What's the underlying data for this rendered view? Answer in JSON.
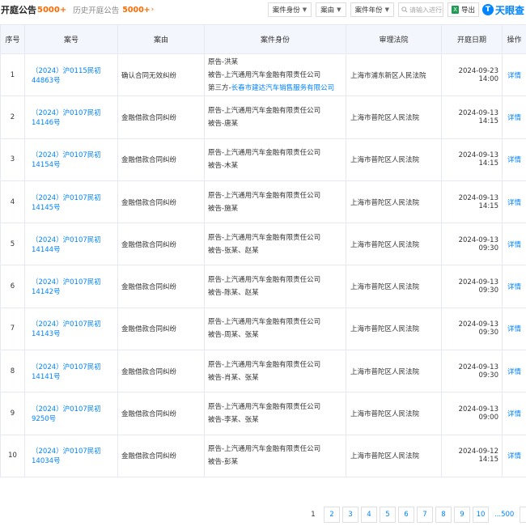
{
  "header": {
    "title": "开庭公告",
    "count": "5000+",
    "history_label": "历史开庭公告",
    "history_count": "5000+",
    "history_arrow": "›"
  },
  "filters": {
    "case_role": "案件身份",
    "cause": "案由",
    "case_year": "案件年份",
    "search_placeholder": "请输入进行搜索",
    "export": "导出",
    "brand": "天眼查"
  },
  "table": {
    "headers": [
      "序号",
      "案号",
      "案由",
      "案件身份",
      "审理法院",
      "开庭日期",
      "操作"
    ],
    "rows": [
      {
        "seq": "1",
        "case_no": "（2024）沪0115民初44863号",
        "reason": "确认合同无效纠纷",
        "parties": [
          "原告-洪某",
          "被告-上汽通用汽车金融有限责任公司"
        ],
        "third_label": "第三方-",
        "third_link": "长春市建达汽车销售服务有限公司",
        "court": "上海市浦东新区人民法院",
        "date": "2024-09-23 14:00",
        "op": "详情"
      },
      {
        "seq": "2",
        "case_no": "（2024）沪0107民初14146号",
        "reason": "金融借款合同纠纷",
        "parties": [
          "原告-上汽通用汽车金融有限责任公司",
          "被告-唐某"
        ],
        "court": "上海市普陀区人民法院",
        "date": "2024-09-13 14:15",
        "op": "详情"
      },
      {
        "seq": "3",
        "case_no": "（2024）沪0107民初14154号",
        "reason": "金融借款合同纠纷",
        "parties": [
          "原告-上汽通用汽车金融有限责任公司",
          "被告-木某"
        ],
        "court": "上海市普陀区人民法院",
        "date": "2024-09-13 14:15",
        "op": "详情"
      },
      {
        "seq": "4",
        "case_no": "（2024）沪0107民初14145号",
        "reason": "金融借款合同纠纷",
        "parties": [
          "原告-上汽通用汽车金融有限责任公司",
          "被告-施某"
        ],
        "court": "上海市普陀区人民法院",
        "date": "2024-09-13 14:15",
        "op": "详情"
      },
      {
        "seq": "5",
        "case_no": "（2024）沪0107民初14144号",
        "reason": "金融借款合同纠纷",
        "parties": [
          "原告-上汽通用汽车金融有限责任公司",
          "被告-张某、赵某"
        ],
        "court": "上海市普陀区人民法院",
        "date": "2024-09-13 09:30",
        "op": "详情"
      },
      {
        "seq": "6",
        "case_no": "（2024）沪0107民初14142号",
        "reason": "金融借款合同纠纷",
        "parties": [
          "原告-上汽通用汽车金融有限责任公司",
          "被告-陈某、赵某"
        ],
        "court": "上海市普陀区人民法院",
        "date": "2024-09-13 09:30",
        "op": "详情"
      },
      {
        "seq": "7",
        "case_no": "（2024）沪0107民初14143号",
        "reason": "金融借款合同纠纷",
        "parties": [
          "原告-上汽通用汽车金融有限责任公司",
          "被告-周某、张某"
        ],
        "court": "上海市普陀区人民法院",
        "date": "2024-09-13 09:30",
        "op": "详情"
      },
      {
        "seq": "8",
        "case_no": "（2024）沪0107民初14141号",
        "reason": "金融借款合同纠纷",
        "parties": [
          "原告-上汽通用汽车金融有限责任公司",
          "被告-肖某、张某"
        ],
        "court": "上海市普陀区人民法院",
        "date": "2024-09-13 09:30",
        "op": "详情"
      },
      {
        "seq": "9",
        "case_no": "（2024）沪0107民初9250号",
        "reason": "金融借款合同纠纷",
        "parties": [
          "原告-上汽通用汽车金融有限责任公司",
          "被告-李某、张某"
        ],
        "court": "上海市普陀区人民法院",
        "date": "2024-09-13 09:00",
        "op": "详情"
      },
      {
        "seq": "10",
        "case_no": "（2024）沪0107民初14034号",
        "reason": "金融借款合同纠纷",
        "parties": [
          "原告-上汽通用汽车金融有限责任公司",
          "被告-彭某"
        ],
        "court": "上海市普陀区人民法院",
        "date": "2024-09-12 14:15",
        "op": "详情"
      }
    ]
  },
  "pagination": {
    "pages": [
      "1",
      "2",
      "3",
      "4",
      "5",
      "6",
      "7",
      "8",
      "9",
      "10"
    ],
    "ellipsis_last": "...500",
    "current": "1",
    "next": "›"
  }
}
